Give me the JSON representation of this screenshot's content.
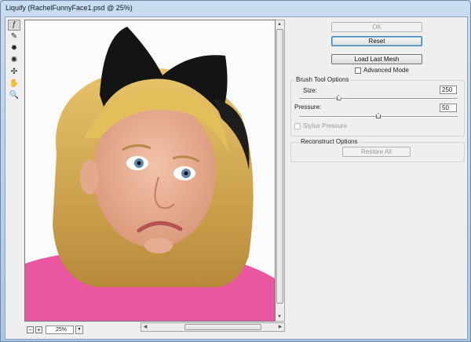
{
  "window": {
    "title": "Liquify (RachelFunnyFace1.psd @ 25%)"
  },
  "tools": [
    {
      "name": "forward-warp-tool-icon",
      "glyph": "ƒ"
    },
    {
      "name": "reconstruct-tool-icon",
      "glyph": "✎"
    },
    {
      "name": "pucker-tool-icon",
      "glyph": "✹"
    },
    {
      "name": "bloat-tool-icon",
      "glyph": "✺"
    },
    {
      "name": "push-left-tool-icon",
      "glyph": "✣"
    },
    {
      "name": "hand-tool-icon",
      "glyph": "✋"
    },
    {
      "name": "zoom-tool-icon",
      "glyph": "🔍"
    }
  ],
  "zoom": {
    "minus": "−",
    "plus": "+",
    "value": "25%",
    "dropdown": "▾"
  },
  "buttons": {
    "ok": "OK",
    "reset": "Reset",
    "load_last_mesh": "Load Last Mesh",
    "restore_all": "Restore All"
  },
  "advanced_mode": {
    "label": "Advanced Mode",
    "checked": false
  },
  "brush_tool_options": {
    "legend": "Brush Tool Options",
    "size_label": "Size:",
    "size_value": "250",
    "size_level": 0.25,
    "pressure_label": "Pressure:",
    "pressure_value": "50",
    "pressure_level": 0.5,
    "stylus_pressure": "Stylus Pressure"
  },
  "reconstruct_options": {
    "legend": "Reconstruct Options"
  },
  "scroll": {
    "up": "▲",
    "down": "▼",
    "left": "◀",
    "right": "▶",
    "grip": "≡"
  }
}
